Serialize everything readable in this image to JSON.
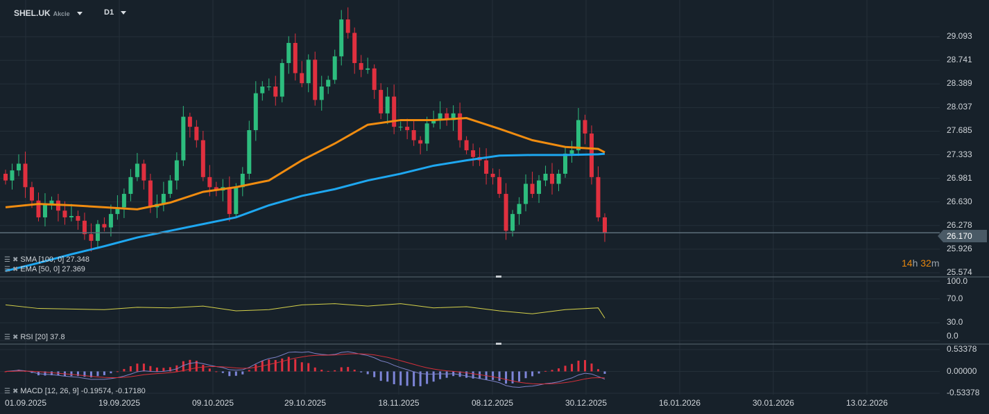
{
  "header": {
    "symbol": "SHEL.UK",
    "asset_type": "Akcie",
    "timeframe": "D1"
  },
  "colors": {
    "up": "#26a69a",
    "up_fill": "#2dbd7e",
    "down": "#e0303f",
    "sma": "#1ea7f0",
    "ema": "#f08c10",
    "rsi": "#d6d24a",
    "macd_line": "#7d82c8",
    "signal_line": "#d8303a",
    "hist_pos": "#e0303f",
    "hist_neg": "#7d85d8",
    "grid": "#243039",
    "current_price_line": "#5d6e7a"
  },
  "indicators": {
    "sma": {
      "label": "SMA [100,  0] 27.348"
    },
    "ema": {
      "label": "EMA [50,  0] 27.369"
    },
    "rsi": {
      "label": "RSI [20]  37.8"
    },
    "macd": {
      "label": "MACD [12,  26,  9] -0.19574,  -0.17180"
    }
  },
  "price_axis": [
    "29.093",
    "28.741",
    "28.389",
    "28.037",
    "27.685",
    "27.333",
    "26.981",
    "26.630",
    "26.278",
    "25.926",
    "25.574"
  ],
  "current_price": "26.170",
  "candle_timer": {
    "hours": "14",
    "h": "h",
    "minutes": "32",
    "m": "m"
  },
  "rsi_axis": [
    "100.0",
    "70.0",
    "30.0",
    "0.0"
  ],
  "macd_axis": [
    "0.53378",
    "0.00000",
    "-0.53378"
  ],
  "date_axis": [
    "01.09.2025",
    "19.09.2025",
    "09.10.2025",
    "29.10.2025",
    "18.11.2025",
    "08.12.2025",
    "30.12.2025",
    "16.01.2026",
    "30.01.2026",
    "13.02.2026"
  ],
  "chart_data": {
    "type": "candlestick",
    "price_range": [
      25.574,
      29.093
    ],
    "closes": [
      26.95,
      27.1,
      27.2,
      26.85,
      26.65,
      26.4,
      26.6,
      26.65,
      26.5,
      26.4,
      26.42,
      26.35,
      26.15,
      26.05,
      26.3,
      26.25,
      26.45,
      26.55,
      26.75,
      27.0,
      27.2,
      26.95,
      26.55,
      26.6,
      26.75,
      26.95,
      27.25,
      27.9,
      27.75,
      27.55,
      27.0,
      26.85,
      26.8,
      26.85,
      26.45,
      26.85,
      27.05,
      27.7,
      28.25,
      28.35,
      28.35,
      28.2,
      28.7,
      29.0,
      28.55,
      28.4,
      28.75,
      28.15,
      28.35,
      28.45,
      28.8,
      29.35,
      29.15,
      28.7,
      28.6,
      28.62,
      28.3,
      27.95,
      28.2,
      27.75,
      27.75,
      27.7,
      27.55,
      27.5,
      27.8,
      27.85,
      27.95,
      27.85,
      27.95,
      27.55,
      27.4,
      27.3,
      27.25,
      27.05,
      27.0,
      26.75,
      26.2,
      26.45,
      26.6,
      26.9,
      26.75,
      26.95,
      27.05,
      26.9,
      27.05,
      27.35,
      27.4,
      27.85,
      27.65,
      27.0,
      26.4,
      26.17
    ],
    "sma_every_5_bars": [
      25.6,
      25.72,
      25.85,
      25.97,
      26.1,
      26.2,
      26.3,
      26.4,
      26.58,
      26.72,
      26.82,
      26.95,
      27.05,
      27.17,
      27.25,
      27.32,
      27.33,
      27.33,
      27.34,
      27.348
    ],
    "ema_every_5_bars": [
      26.55,
      26.6,
      26.58,
      26.55,
      26.52,
      26.62,
      26.78,
      26.85,
      26.95,
      27.25,
      27.5,
      27.78,
      27.85,
      27.85,
      27.88,
      27.72,
      27.55,
      27.45,
      27.42,
      27.369
    ],
    "rsi_every_5_bars": [
      60,
      54,
      53,
      52,
      56,
      55,
      58,
      50,
      52,
      60,
      62,
      58,
      62,
      55,
      57,
      50,
      45,
      52,
      55,
      37.8
    ],
    "rsi_range": [
      0,
      100
    ],
    "macd_range": [
      -0.53378,
      0.53378
    ]
  }
}
